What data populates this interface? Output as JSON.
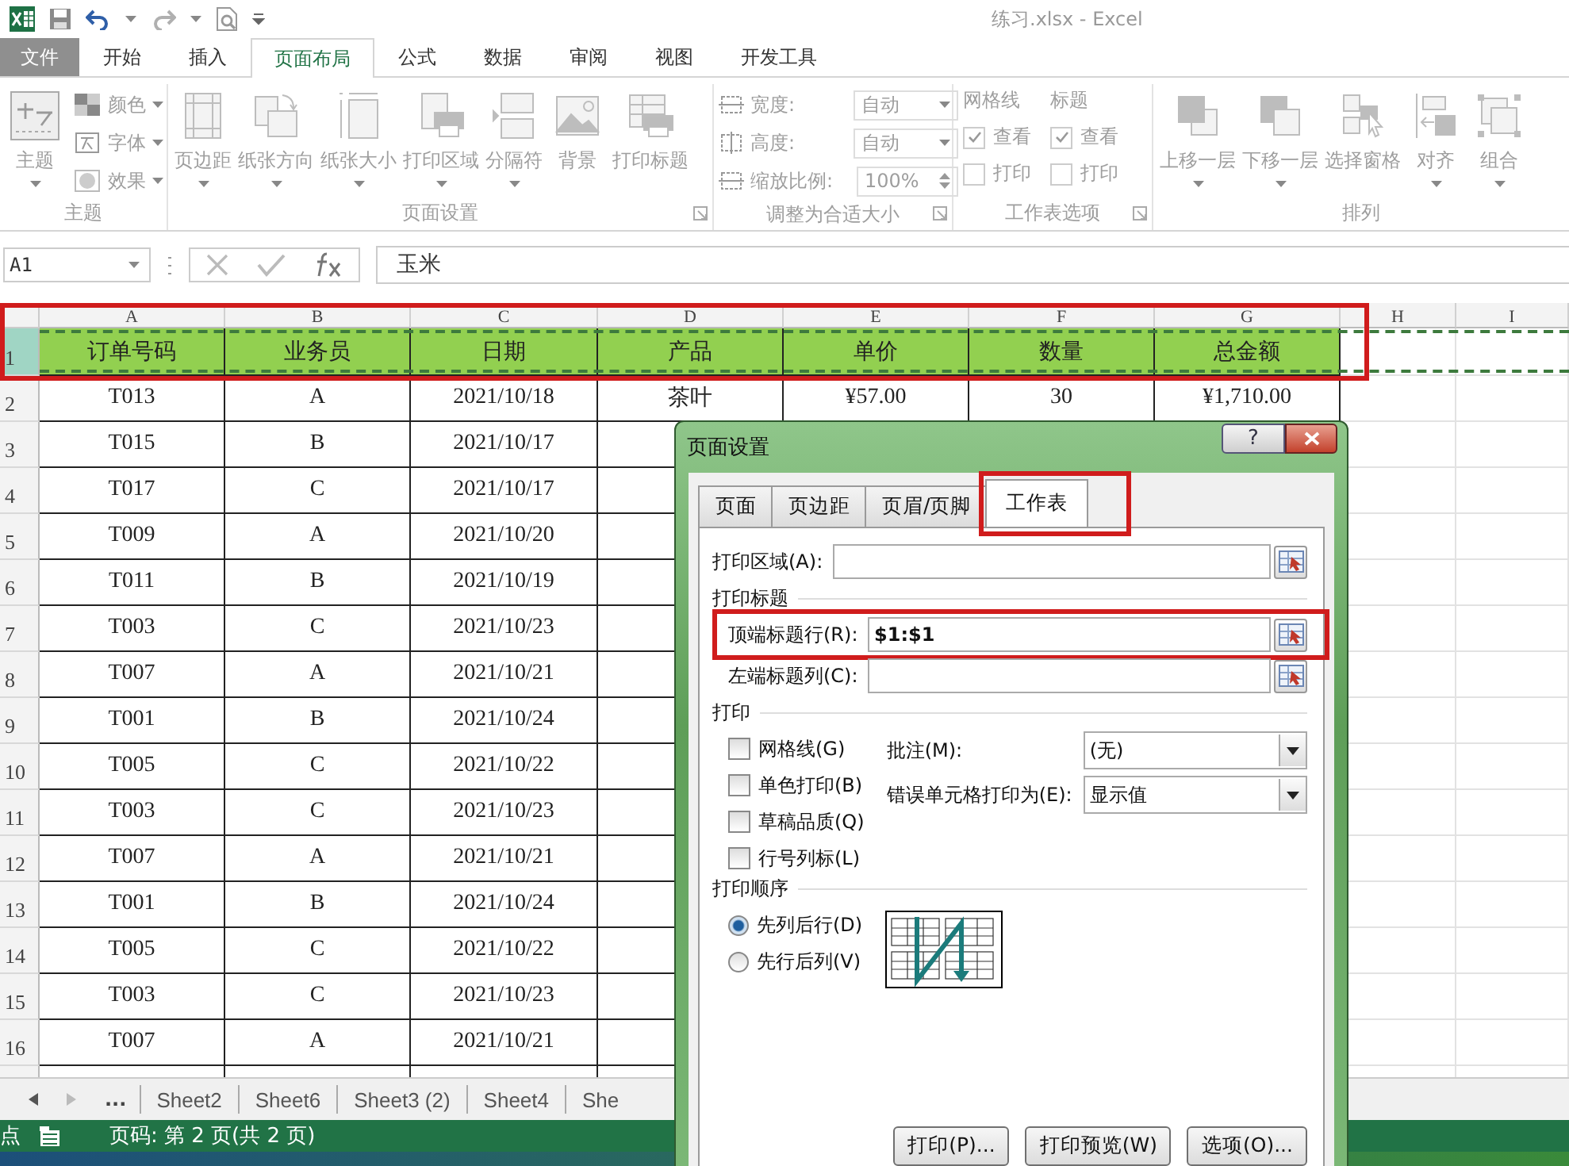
{
  "title_bar": {
    "title": "练习.xlsx - Excel"
  },
  "ribbon_tabs": [
    {
      "label": "文件",
      "kind": "file",
      "selected": false
    },
    {
      "label": "开始",
      "kind": "tab",
      "selected": false
    },
    {
      "label": "插入",
      "kind": "tab",
      "selected": false
    },
    {
      "label": "页面布局",
      "kind": "tab",
      "selected": true
    },
    {
      "label": "公式",
      "kind": "tab",
      "selected": false
    },
    {
      "label": "数据",
      "kind": "tab",
      "selected": false
    },
    {
      "label": "审阅",
      "kind": "tab",
      "selected": false
    },
    {
      "label": "视图",
      "kind": "tab",
      "selected": false
    },
    {
      "label": "开发工具",
      "kind": "tab",
      "selected": false
    }
  ],
  "ribbon": {
    "disabled": true,
    "groups": [
      {
        "kind": "themes",
        "label": "主题",
        "launcher": false,
        "main": "主题",
        "items": [
          {
            "label": "颜色"
          },
          {
            "label": "字体"
          },
          {
            "label": "效果"
          }
        ]
      },
      {
        "kind": "buttons",
        "label": "页面设置",
        "launcher": true,
        "buttons": [
          {
            "label": "页边距",
            "dropdown": true
          },
          {
            "label": "纸张方向",
            "dropdown": true
          },
          {
            "label": "纸张大小",
            "dropdown": true
          },
          {
            "label": "打印区域",
            "dropdown": true
          },
          {
            "label": "分隔符",
            "dropdown": true
          },
          {
            "label": "背景",
            "dropdown": false
          },
          {
            "label": "打印标题",
            "dropdown": false
          }
        ]
      },
      {
        "kind": "scale",
        "label": "调整为合适大小",
        "launcher": true,
        "fields": [
          {
            "label": "宽度:",
            "value": "自动",
            "kind": "dropdown"
          },
          {
            "label": "高度:",
            "value": "自动",
            "kind": "dropdown"
          },
          {
            "label": "缩放比例:",
            "value": "100%",
            "kind": "spinner"
          }
        ]
      },
      {
        "kind": "options",
        "label": "工作表选项",
        "launcher": true,
        "columns": [
          {
            "heading": "网格线",
            "items": [
              {
                "label": "查看",
                "checked": true
              },
              {
                "label": "打印",
                "checked": false
              }
            ]
          },
          {
            "heading": "标题",
            "items": [
              {
                "label": "查看",
                "checked": true
              },
              {
                "label": "打印",
                "checked": false
              }
            ]
          }
        ]
      },
      {
        "kind": "buttons",
        "label": "排列",
        "launcher": false,
        "buttons": [
          {
            "label": "上移一层",
            "dropdown": true
          },
          {
            "label": "下移一层",
            "dropdown": true
          },
          {
            "label": "选择窗格",
            "dropdown": false
          },
          {
            "label": "对齐",
            "dropdown": true
          },
          {
            "label": "组合",
            "dropdown": true
          }
        ]
      }
    ]
  },
  "formula_bar": {
    "name_box": "A1",
    "formula": "玉米"
  },
  "sheet": {
    "columns": [
      "A",
      "B",
      "C",
      "D",
      "E",
      "F",
      "G",
      "H",
      "I"
    ],
    "header_highlighted": true,
    "print_titles_marked": true,
    "rows": [
      {
        "number": "1",
        "kind": "header",
        "cells": [
          "订单号码",
          "业务员",
          "日期",
          "产品",
          "单价",
          "数量",
          "总金额"
        ]
      },
      {
        "number": "2",
        "kind": "data",
        "cells": [
          "T013",
          "A",
          "2021/10/18",
          "茶叶",
          "¥57.00",
          "30",
          "¥1,710.00"
        ]
      },
      {
        "number": "3",
        "kind": "data",
        "cells": [
          "T015",
          "B",
          "2021/10/17"
        ]
      },
      {
        "number": "4",
        "kind": "data",
        "cells": [
          "T017",
          "C",
          "2021/10/17"
        ]
      },
      {
        "number": "5",
        "kind": "data",
        "cells": [
          "T009",
          "A",
          "2021/10/20"
        ]
      },
      {
        "number": "6",
        "kind": "data",
        "cells": [
          "T011",
          "B",
          "2021/10/19"
        ]
      },
      {
        "number": "7",
        "kind": "data",
        "cells": [
          "T003",
          "C",
          "2021/10/23"
        ]
      },
      {
        "number": "8",
        "kind": "data",
        "cells": [
          "T007",
          "A",
          "2021/10/21"
        ]
      },
      {
        "number": "9",
        "kind": "data",
        "cells": [
          "T001",
          "B",
          "2021/10/24"
        ]
      },
      {
        "number": "10",
        "kind": "data",
        "cells": [
          "T005",
          "C",
          "2021/10/22"
        ]
      },
      {
        "number": "11",
        "kind": "data",
        "cells": [
          "T003",
          "C",
          "2021/10/23"
        ]
      },
      {
        "number": "12",
        "kind": "data",
        "cells": [
          "T007",
          "A",
          "2021/10/21"
        ]
      },
      {
        "number": "13",
        "kind": "data",
        "cells": [
          "T001",
          "B",
          "2021/10/24"
        ]
      },
      {
        "number": "14",
        "kind": "data",
        "cells": [
          "T005",
          "C",
          "2021/10/22"
        ]
      },
      {
        "number": "15",
        "kind": "data",
        "cells": [
          "T003",
          "C",
          "2021/10/23"
        ]
      },
      {
        "number": "16",
        "kind": "data",
        "cells": [
          "T007",
          "A",
          "2021/10/21"
        ]
      }
    ]
  },
  "sheet_tabs": {
    "more": "...",
    "tabs": [
      {
        "label": "Sheet2",
        "selected": false
      },
      {
        "label": "Sheet6",
        "selected": false
      },
      {
        "label": "Sheet3 (2)",
        "selected": false
      },
      {
        "label": "Sheet4",
        "selected": false
      },
      {
        "label": "She",
        "selected": false
      }
    ]
  },
  "status_bar": {
    "mode": "点",
    "page": "页码: 第 2 页(共 2 页)"
  },
  "dialog": {
    "title": "页面设置",
    "help": "?",
    "tabs": [
      {
        "label": "页面",
        "selected": false,
        "highlighted": false
      },
      {
        "label": "页边距",
        "selected": false,
        "highlighted": false
      },
      {
        "label": "页眉/页脚",
        "selected": false,
        "highlighted": false
      },
      {
        "label": "工作表",
        "selected": true,
        "highlighted": true
      }
    ],
    "print_area": {
      "label": "打印区域(A):"
    },
    "titles": {
      "heading": "打印标题",
      "fields": [
        {
          "label": "顶端标题行(R):",
          "value": "$1:$1",
          "highlighted": true
        },
        {
          "label": "左端标题列(C):",
          "highlighted": false
        }
      ]
    },
    "print": {
      "heading": "打印",
      "checkboxes": [
        {
          "label": "网格线(G)",
          "checked": false
        },
        {
          "label": "单色打印(B)",
          "checked": false
        },
        {
          "label": "草稿品质(Q)",
          "checked": false
        },
        {
          "label": "行号列标(L)",
          "checked": false
        }
      ],
      "selects": [
        {
          "label": "批注(M):",
          "value": "(无)"
        },
        {
          "label": "错误单元格打印为(E):",
          "value": "显示值"
        }
      ]
    },
    "order": {
      "heading": "打印顺序",
      "options": [
        {
          "label": "先列后行(D)",
          "selected": true
        },
        {
          "label": "先行后列(V)",
          "selected": false
        }
      ]
    },
    "buttons": [
      "打印(P)...",
      "打印预览(W)",
      "选项(O)..."
    ]
  }
}
